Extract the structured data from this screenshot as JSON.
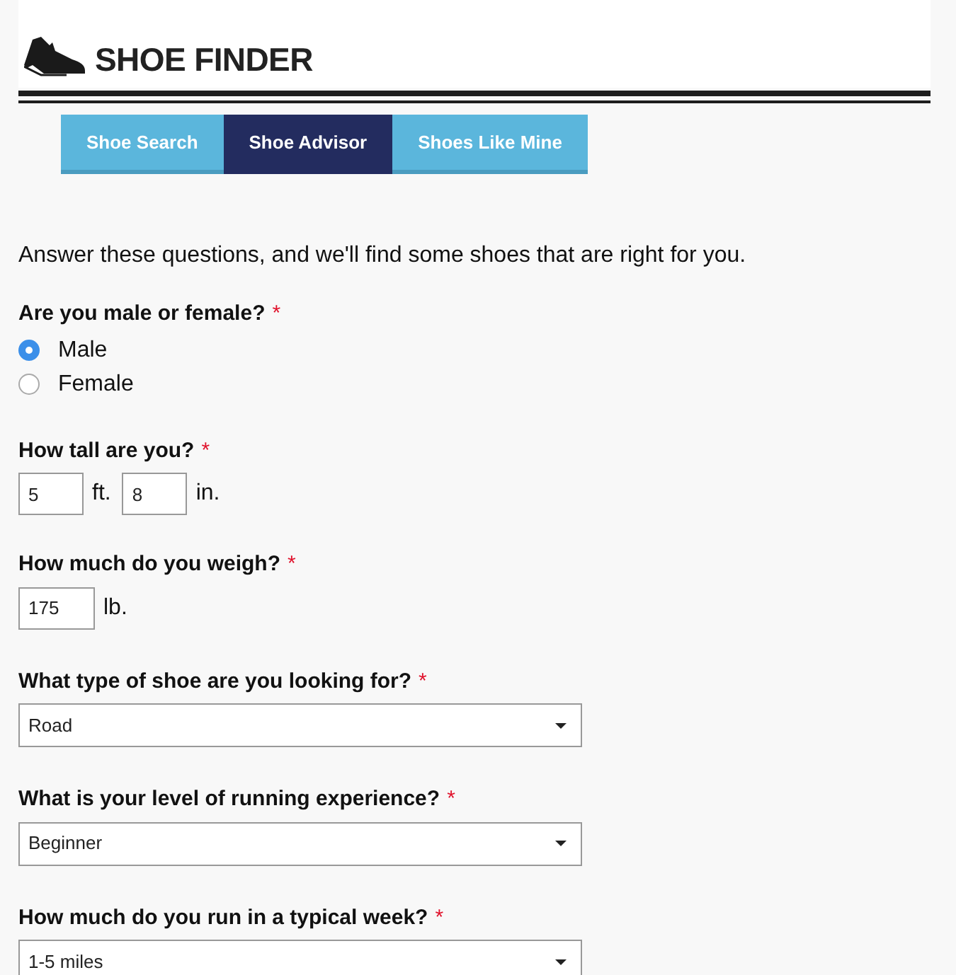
{
  "header": {
    "title": "SHOE FINDER"
  },
  "tabs": [
    {
      "label": "Shoe Search",
      "selected": false
    },
    {
      "label": "Shoe Advisor",
      "selected": true
    },
    {
      "label": "Shoes Like Mine",
      "selected": false
    }
  ],
  "intro": "Answer these questions, and we'll find some shoes that are right for you.",
  "questions": [
    {
      "kind": "radio",
      "label": "Are you male or female?",
      "required_mark": "*",
      "options": [
        {
          "label": "Male",
          "selected": true
        },
        {
          "label": "Female",
          "selected": false
        }
      ]
    },
    {
      "kind": "measure",
      "label": "How tall are you?",
      "required_mark": "*",
      "fields": [
        {
          "value": "5",
          "unit": "ft."
        },
        {
          "value": "8",
          "unit": "in."
        }
      ]
    },
    {
      "kind": "measure",
      "label": "How much do you weigh?",
      "required_mark": "*",
      "fields": [
        {
          "value": "175",
          "unit": "lb."
        }
      ]
    },
    {
      "kind": "select",
      "label": "What type of shoe are you looking for?",
      "required_mark": "*",
      "value": "Road"
    },
    {
      "kind": "select",
      "label": "What is your level of running experience?",
      "required_mark": "*",
      "value": "Beginner"
    },
    {
      "kind": "select",
      "label": "How much do you run in a typical week?",
      "required_mark": "*",
      "value": "1-5 miles"
    }
  ]
}
